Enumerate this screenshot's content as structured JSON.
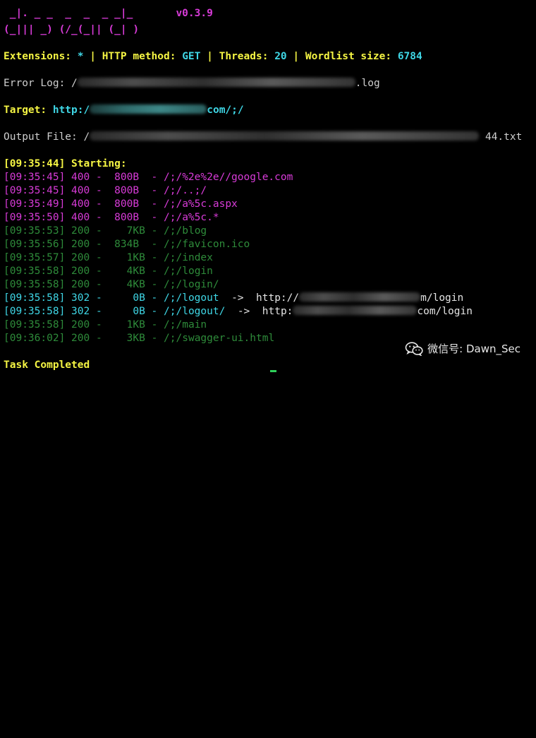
{
  "banner": {
    "art_line1": " _|. _ _  _  _  _ _|_    ",
    "version": "v0.3.9",
    "art_line2": "(_||| _) (/_(_|| (_| )"
  },
  "config": {
    "ext_label": "Extensions: ",
    "ext_value": "*",
    "sep1": " | ",
    "method_label": "HTTP method: ",
    "method_value": "GET",
    "sep2": " | ",
    "threads_label": "Threads: ",
    "threads_value": "20",
    "sep3": " | ",
    "wordlist_label": "Wordlist size: ",
    "wordlist_value": "6784"
  },
  "error_log": {
    "label": "Error Log: ",
    "prefix": "/",
    "suffix": ".log"
  },
  "target": {
    "label": "Target: ",
    "prefix": "http:/",
    "suffix": "com/;/"
  },
  "output_file": {
    "label": "Output File: ",
    "prefix": "/",
    "suffix": "44.txt"
  },
  "starting": {
    "time": "[09:35:44]",
    "text": " Starting:"
  },
  "results": [
    {
      "time": "[09:35:45]",
      "status": "400",
      "size": "800B",
      "path": "/;/%2e%2e//google.com",
      "redirect": null
    },
    {
      "time": "[09:35:45]",
      "status": "400",
      "size": "800B",
      "path": "/;/..;/",
      "redirect": null
    },
    {
      "time": "[09:35:49]",
      "status": "400",
      "size": "800B",
      "path": "/;/a%5c.aspx",
      "redirect": null
    },
    {
      "time": "[09:35:50]",
      "status": "400",
      "size": "800B",
      "path": "/;/a%5c.*",
      "redirect": null
    },
    {
      "time": "[09:35:53]",
      "status": "200",
      "size": "7KB",
      "path": "/;/blog",
      "redirect": null
    },
    {
      "time": "[09:35:56]",
      "status": "200",
      "size": "834B",
      "path": "/;/favicon.ico",
      "redirect": null
    },
    {
      "time": "[09:35:57]",
      "status": "200",
      "size": "1KB",
      "path": "/;/index",
      "redirect": null
    },
    {
      "time": "[09:35:58]",
      "status": "200",
      "size": "4KB",
      "path": "/;/login",
      "redirect": null
    },
    {
      "time": "[09:35:58]",
      "status": "200",
      "size": "4KB",
      "path": "/;/login/",
      "redirect": null
    },
    {
      "time": "[09:35:58]",
      "status": "302",
      "size": "0B",
      "path": "/;/logout",
      "redirect": {
        "arrow": "->",
        "prefix": "http://",
        "suffix": "m/login"
      }
    },
    {
      "time": "[09:35:58]",
      "status": "302",
      "size": "0B",
      "path": "/;/logout/",
      "redirect": {
        "arrow": "->",
        "prefix": "http:",
        "suffix": "com/login"
      }
    },
    {
      "time": "[09:35:58]",
      "status": "200",
      "size": "1KB",
      "path": "/;/main",
      "redirect": null
    },
    {
      "time": "[09:36:02]",
      "status": "200",
      "size": "3KB",
      "path": "/;/swagger-ui.html",
      "redirect": null
    }
  ],
  "footer": {
    "completed": "Task Completed"
  },
  "watermark": {
    "text": "微信号: Dawn_Sec",
    "icon": "wechat-icon"
  },
  "colors": {
    "background": "#000000",
    "status_400": "#d83bd8",
    "status_200": "#2e8b3a",
    "status_302": "#3fd7e6",
    "header_yellow": "#f5f543",
    "header_value_cyan": "#3fd7e6",
    "cursor": "#2fd05a"
  }
}
